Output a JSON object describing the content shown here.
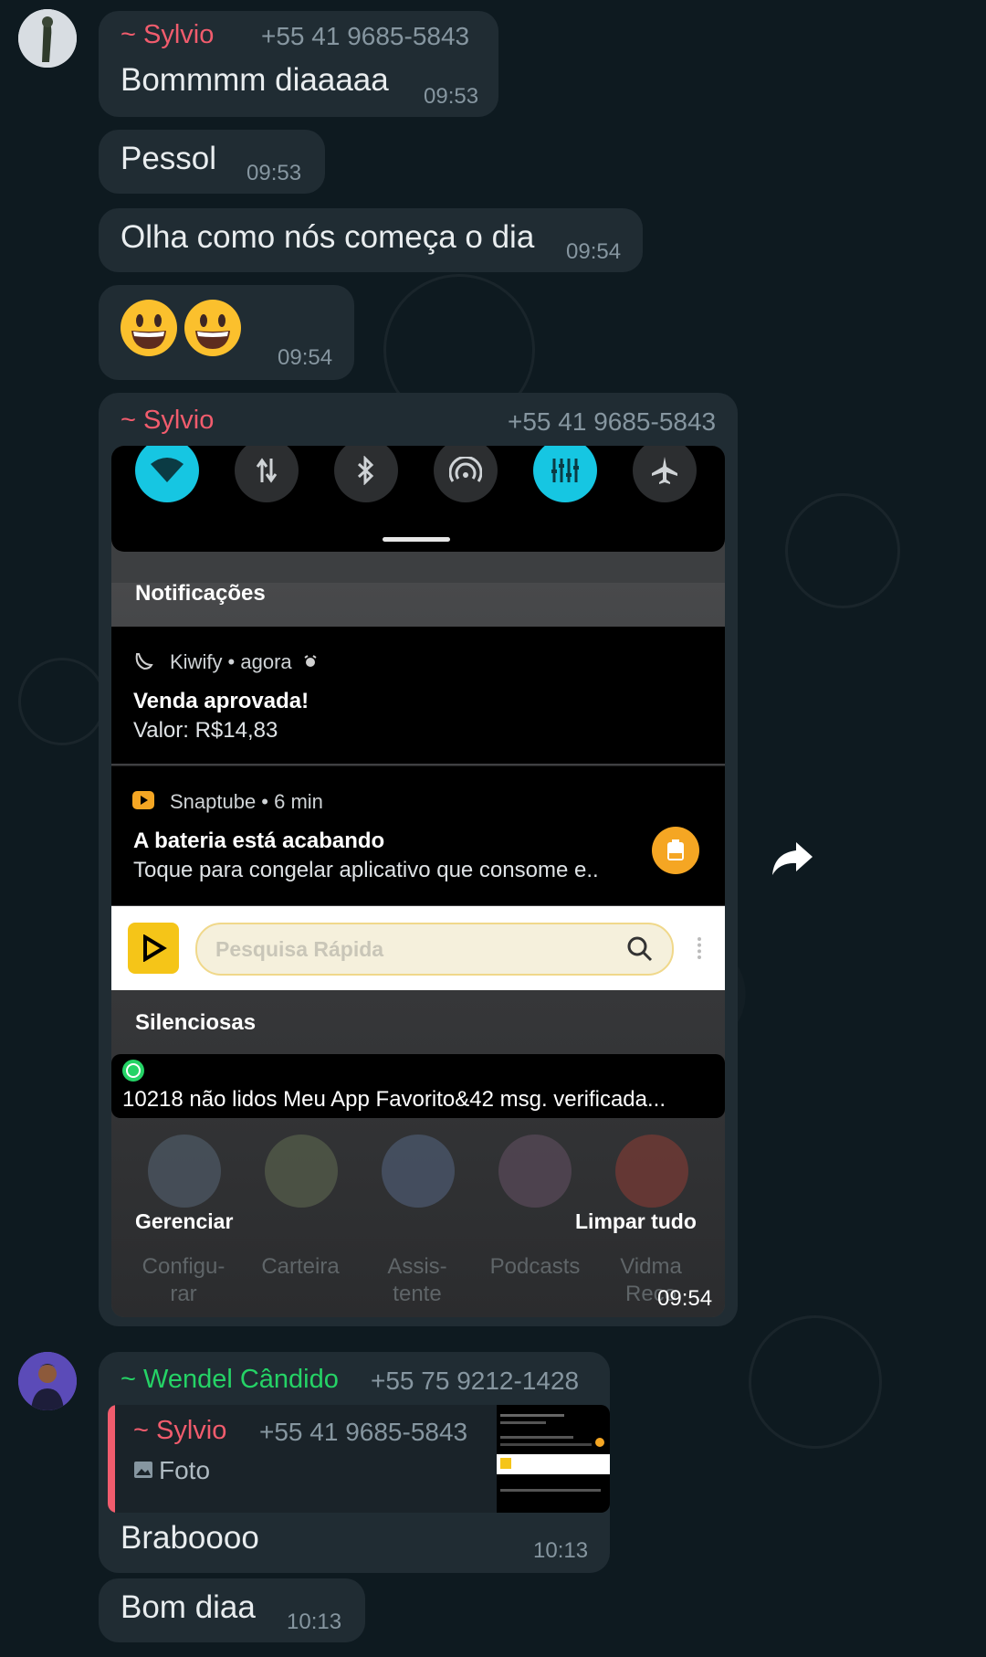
{
  "chat": {
    "messages": [
      {
        "sender": "~ Sylvio",
        "phone": "+55 41 9685-5843",
        "text": "Bommmm diaaaaa",
        "time": "09:53"
      },
      {
        "text": "Pessol",
        "time": "09:53"
      },
      {
        "text": "Olha como nós começa o dia",
        "time": "09:54"
      },
      {
        "text": "😃😃",
        "time": "09:54"
      },
      {
        "sender": "~ Sylvio",
        "phone": "+55 41 9685-5843",
        "time": "09:54"
      },
      {
        "sender": "~ Wendel Cândido",
        "phone": "+55 75 9212-1428",
        "text": "Braboooo",
        "time": "10:13"
      },
      {
        "text": "Bom diaa",
        "time": "10:13"
      }
    ],
    "quote": {
      "sender": "~ Sylvio",
      "phone": "+55 41 9685-5843",
      "label": "Foto"
    },
    "colors": {
      "sylvio": "#f15c6d",
      "wendel": "#25d366",
      "bubble": "#202c33"
    }
  },
  "screenshot": {
    "quick_settings": [
      "wifi-icon",
      "data-icon",
      "bluetooth-icon",
      "hotspot-icon",
      "equalizer-icon",
      "airplane-icon"
    ],
    "notifications_label": "Notificações",
    "notif1": {
      "app": "Kiwify • agora",
      "title": "Venda aprovada!",
      "body": "Valor: R$14,83"
    },
    "notif2": {
      "app": "Snaptube • 6 min",
      "title": "A bateria está acabando",
      "body": "Toque para congelar aplicativo que consome e.."
    },
    "search_placeholder": "Pesquisa Rápida",
    "silent_label": "Silenciosas",
    "whatsapp_notif": "10218 não lidos Meu App Favorito&42 msg. verificada...",
    "manage": "Gerenciar",
    "clear_all": "Limpar tudo",
    "dock": [
      "Configu-\nrar",
      "Carteira",
      "Assis-\ntente",
      "Podcasts",
      "Vidma\nReco"
    ]
  }
}
